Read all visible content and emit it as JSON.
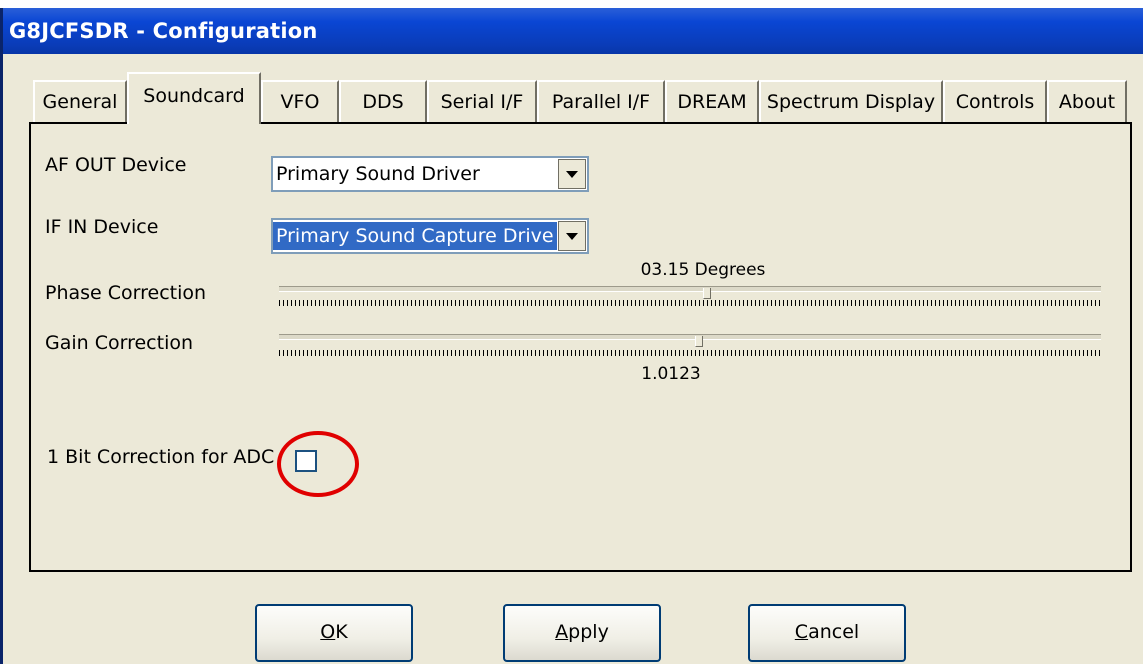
{
  "window": {
    "title": "G8JCFSDR - Configuration"
  },
  "tabs": [
    {
      "label": "General"
    },
    {
      "label": "Soundcard"
    },
    {
      "label": "VFO"
    },
    {
      "label": "DDS"
    },
    {
      "label": "Serial I/F"
    },
    {
      "label": "Parallel I/F"
    },
    {
      "label": "DREAM"
    },
    {
      "label": "Spectrum Display"
    },
    {
      "label": "Controls"
    },
    {
      "label": "About"
    }
  ],
  "active_tab": "Soundcard",
  "soundcard": {
    "af_out": {
      "label": "AF OUT Device",
      "value": "Primary Sound Driver"
    },
    "if_in": {
      "label": "IF IN Device",
      "value": "Primary Sound Capture Drive"
    },
    "phase": {
      "label": "Phase Correction",
      "value_text": "03.15 Degrees",
      "position": 0.52
    },
    "gain": {
      "label": "Gain Correction",
      "value_text": "1.0123",
      "position": 0.51
    },
    "one_bit": {
      "label": "1 Bit Correction for ADC",
      "checked": false
    }
  },
  "buttons": {
    "ok": {
      "mnemonic": "O",
      "rest": "K"
    },
    "apply": {
      "mnemonic": "A",
      "rest": "pply"
    },
    "cancel": {
      "mnemonic": "C",
      "rest": "ancel"
    }
  },
  "colors": {
    "title_bar": "#0a46d4",
    "annotation_circle": "#e00000"
  }
}
